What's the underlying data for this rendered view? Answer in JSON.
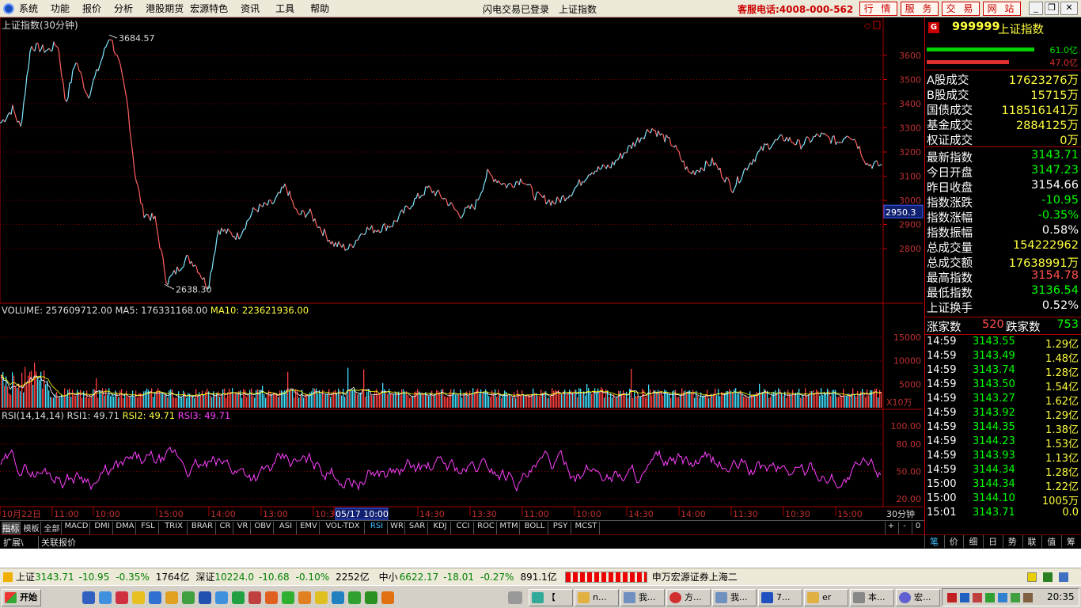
{
  "menu": {
    "items": [
      "系统",
      "功能",
      "报价",
      "分析",
      "港股期货",
      "宏源特色",
      "资讯",
      "工具",
      "帮助"
    ],
    "login_status": "闪电交易已登录",
    "current_index": "上证指数",
    "service_phone": "客服电话:4008-000-562",
    "right_buttons": [
      "行 情",
      "服 务",
      "交 易",
      "网 站"
    ]
  },
  "main_chart": {
    "title": "上证指数(30分钟)",
    "high_label": "3684.57",
    "low_label": "2638.30",
    "current_price_tag": "2950.3",
    "y_ticks": [
      "3600",
      "3500",
      "3400",
      "3300",
      "3200",
      "3100",
      "3000",
      "2900",
      "2800"
    ]
  },
  "volume": {
    "label_volume": "VOLUME: 257609712.00",
    "label_ma5": "MA5: 176331168.00",
    "label_ma10": "MA10: 223621936.00",
    "y_ticks": [
      "15000",
      "10000",
      "5000"
    ],
    "unit": "X10万"
  },
  "rsi": {
    "label_name": "RSI(14,14,14)",
    "label_rsi1": "RSI1: 49.71",
    "label_rsi2": "RSI2: 49.71",
    "label_rsi3": "RSI3: 49.71",
    "y_ticks": [
      "100.00",
      "80.00",
      "50.00",
      "20.00"
    ]
  },
  "time_axis": {
    "labels": [
      "10月22日",
      "11:00",
      "10:00",
      "15:00",
      "14:00",
      "13:00",
      "10:30",
      "05/17 10:00",
      "14:30",
      "13:30",
      "11:00",
      "10:00",
      "14:30",
      "14:00",
      "11:30",
      "10:30",
      "15:00"
    ],
    "period": "30分钟"
  },
  "indicator_tabs": [
    "指标",
    "模板",
    "全部",
    "MACD",
    "DMI",
    "DMA",
    "FSL",
    "TRIX",
    "BRAR",
    "CR",
    "VR",
    "OBV",
    "ASI",
    "EMV",
    "VOL-TDX",
    "RSI",
    "WR",
    "SAR",
    "KDJ",
    "CCI",
    "ROC",
    "MTM",
    "BOLL",
    "PSY",
    "MCST"
  ],
  "indicator_controls": [
    "+",
    "-",
    "0"
  ],
  "extension_tabs": [
    "扩展\\",
    "关联报价"
  ],
  "side_panel": {
    "code": "999999",
    "name": "上证指数",
    "buy_volume": "61.0亿",
    "sell_volume": "47.0亿",
    "stats1": [
      {
        "label": "A股成交",
        "value": "17623276万"
      },
      {
        "label": "B股成交",
        "value": "15715万"
      },
      {
        "label": "国债成交",
        "value": "118516141万"
      },
      {
        "label": "基金成交",
        "value": "2884125万"
      },
      {
        "label": "权证成交",
        "value": "0万"
      }
    ],
    "stats2": [
      {
        "label": "最新指数",
        "value": "3143.71"
      },
      {
        "label": "今日开盘",
        "value": "3147.23"
      },
      {
        "label": "昨日收盘",
        "value": "3154.66"
      },
      {
        "label": "指数涨跌",
        "value": "-10.95"
      },
      {
        "label": "指数涨幅",
        "value": "-0.35%"
      },
      {
        "label": "指数振幅",
        "value": "0.58%"
      },
      {
        "label": "总成交量",
        "value": "154222962"
      },
      {
        "label": "总成交额",
        "value": "17638991万"
      },
      {
        "label": "最高指数",
        "value": "3154.78"
      },
      {
        "label": "最低指数",
        "value": "3136.54"
      },
      {
        "label": "上证换手",
        "value": "0.52%"
      }
    ],
    "up_label": "涨家数",
    "up_count": "520",
    "down_label": "跌家数",
    "down_count": "753",
    "ticks": [
      {
        "time": "14:59",
        "price": "3143.55",
        "amount": "1.29亿"
      },
      {
        "time": "14:59",
        "price": "3143.49",
        "amount": "1.48亿"
      },
      {
        "time": "14:59",
        "price": "3143.74",
        "amount": "1.28亿"
      },
      {
        "time": "14:59",
        "price": "3143.50",
        "amount": "1.54亿"
      },
      {
        "time": "14:59",
        "price": "3143.27",
        "amount": "1.62亿"
      },
      {
        "time": "14:59",
        "price": "3143.92",
        "amount": "1.29亿"
      },
      {
        "time": "14:59",
        "price": "3144.35",
        "amount": "1.38亿"
      },
      {
        "time": "14:59",
        "price": "3144.23",
        "amount": "1.53亿"
      },
      {
        "time": "14:59",
        "price": "3143.93",
        "amount": "1.13亿"
      },
      {
        "time": "14:59",
        "price": "3144.34",
        "amount": "1.28亿"
      },
      {
        "time": "15:00",
        "price": "3144.34",
        "amount": "1.22亿"
      },
      {
        "time": "15:00",
        "price": "3144.10",
        "amount": "1005万"
      },
      {
        "time": "15:01",
        "price": "3143.71",
        "amount": "0.0"
      }
    ],
    "bottom_tabs": [
      "笔",
      "价",
      "细",
      "日",
      "势",
      "联",
      "值",
      "筹"
    ]
  },
  "ticker": {
    "sh_name": "上证",
    "sh_price": "3143.71",
    "sh_change": "-10.95",
    "sh_pct": "-0.35%",
    "sh_amount": "1764亿",
    "sz_name": "深证",
    "sz_price": "10224.0",
    "sz_change": "-10.68",
    "sz_pct": "-0.10%",
    "sz_amount": "2252亿",
    "zx_name": "中小",
    "zx_price": "6622.17",
    "zx_change": "-18.01",
    "zx_pct": "-0.27%",
    "zx_amount": "891.1亿",
    "broker": "申万宏源证券上海二"
  },
  "taskbar": {
    "start": "开始",
    "windows": [
      "",
      "n...",
      "我...",
      "方...",
      "我...",
      "7...",
      "er",
      "本...",
      "宏..."
    ],
    "clock": "20:35"
  },
  "colors": {
    "up": "#ff5050",
    "down": "#00ff00",
    "price_line": "#80e8ff",
    "ma5": "#ffff00",
    "rsi": "#ff40ff"
  }
}
